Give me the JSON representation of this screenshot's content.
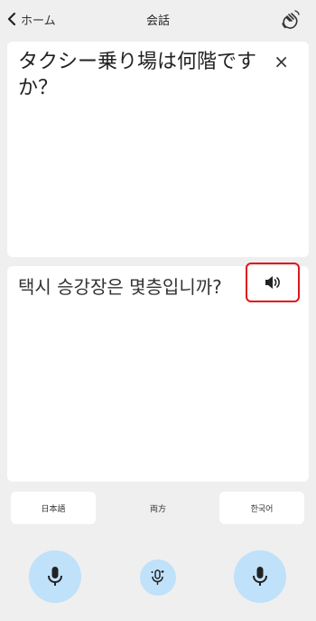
{
  "header": {
    "back_label": "ホーム",
    "title": "会話"
  },
  "source": {
    "text": "タクシー乗り場は何階ですか？",
    "close_label": "×"
  },
  "translation": {
    "text": "택시 승강장은 몇층입니까?"
  },
  "languages": {
    "left": "日本語",
    "middle": "両方",
    "right": "한국어"
  }
}
